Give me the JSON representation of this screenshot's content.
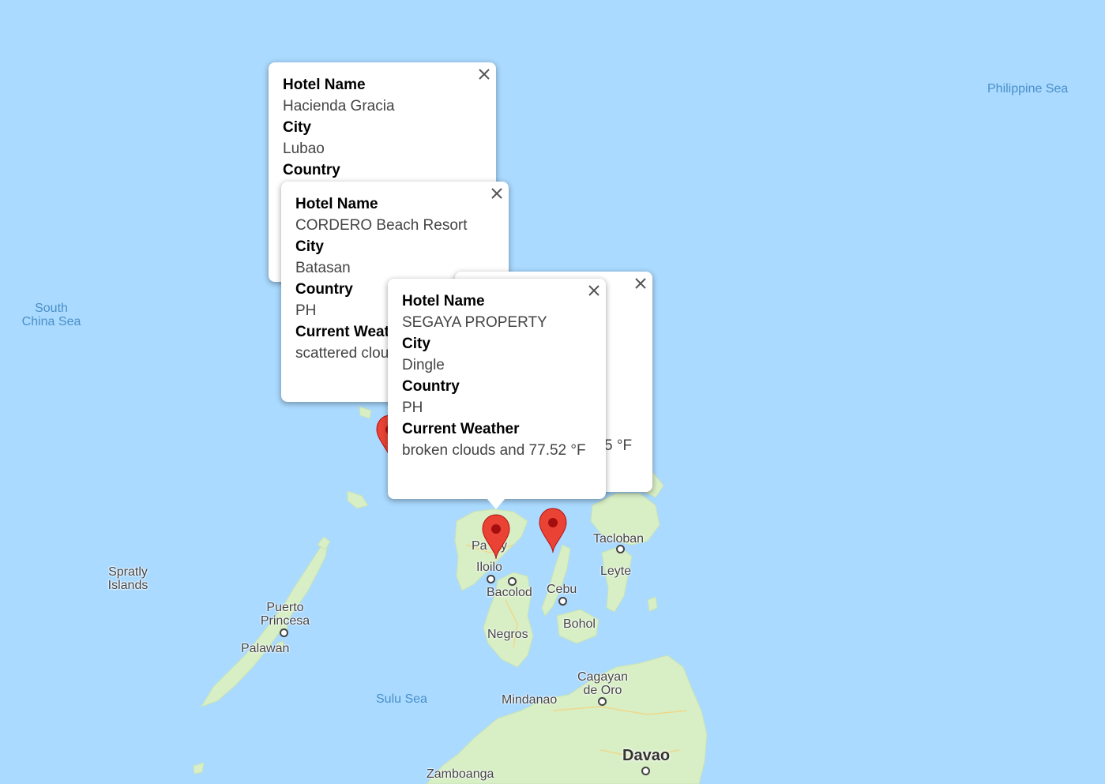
{
  "map": {
    "sea_labels": {
      "philippine_sea": "Philippine Sea",
      "south_china_sea_1": "South",
      "south_china_sea_2": "China Sea",
      "sulu_sea": "Sulu Sea"
    },
    "place_labels": {
      "spratly_1": "Spratly",
      "spratly_2": "Islands",
      "puerto_1": "Puerto",
      "puerto_2": "Princesa",
      "palawan": "Palawan",
      "panay_pre": "Pa",
      "panay_post": "y",
      "iloilo": "Iloilo",
      "bacolod": "Bacolod",
      "cebu": "Cebu",
      "negros": "Negros",
      "bohol": "Bohol",
      "tacloban": "Tacloban",
      "leyte": "Leyte",
      "cagayan_1": "Cagayan",
      "cagayan_2": "de Oro",
      "mindanao": "Mindanao",
      "davao": "Davao",
      "zamboanga": "Zamboanga"
    },
    "colors": {
      "water": "#aadaff",
      "land": "#d8efc6",
      "marker": "#ea4335"
    }
  },
  "info_windows": [
    {
      "fields": [
        {
          "label": "Hotel Name",
          "value": "Hacienda Gracia"
        },
        {
          "label": "City",
          "value": "Lubao"
        },
        {
          "label": "Country",
          "value": ""
        }
      ]
    },
    {
      "fields": [
        {
          "label": "Hotel Name",
          "value": "CORDERO Beach Resort"
        },
        {
          "label": "City",
          "value": "Batasan"
        },
        {
          "label": "Country",
          "value": "PH"
        },
        {
          "label": "Current Weat",
          "value": "scattered clou"
        }
      ]
    },
    {
      "partial_text": "5 °F"
    },
    {
      "fields": [
        {
          "label": "Hotel Name",
          "value": "SEGAYA PROPERTY"
        },
        {
          "label": "City",
          "value": "Dingle"
        },
        {
          "label": "Country",
          "value": "PH"
        },
        {
          "label": "Current Weather",
          "value": "broken clouds and 77.52 °F"
        }
      ]
    }
  ],
  "icons": {
    "close": "close-icon",
    "marker": "map-pin-icon"
  }
}
